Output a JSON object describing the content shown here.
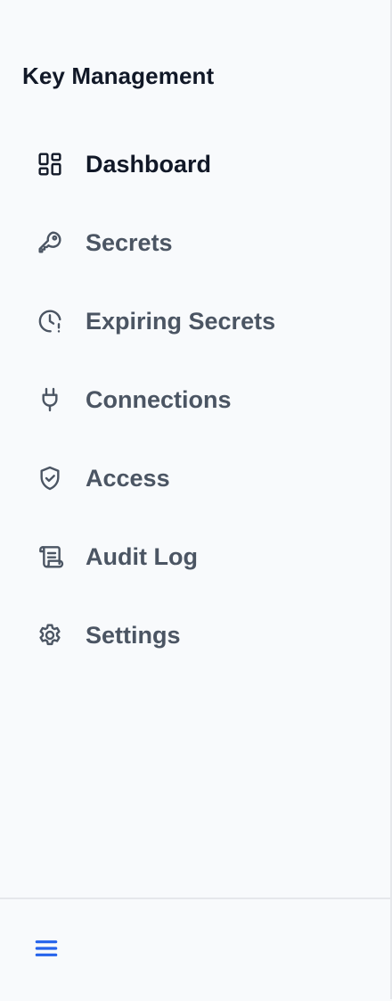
{
  "sidebar": {
    "title": "Key Management",
    "items": [
      {
        "label": "Dashboard",
        "icon": "dashboard-icon",
        "active": true
      },
      {
        "label": "Secrets",
        "icon": "key-icon",
        "active": false
      },
      {
        "label": "Expiring Secrets",
        "icon": "clock-alert-icon",
        "active": false
      },
      {
        "label": "Connections",
        "icon": "plug-icon",
        "active": false
      },
      {
        "label": "Access",
        "icon": "shield-check-icon",
        "active": false
      },
      {
        "label": "Audit Log",
        "icon": "scroll-icon",
        "active": false
      },
      {
        "label": "Settings",
        "icon": "gear-icon",
        "active": false
      }
    ]
  },
  "footer": {
    "menu_icon": "hamburger-menu-icon"
  },
  "colors": {
    "background": "#f8fafc",
    "text_active": "#111827",
    "text_default": "#4b5563",
    "accent": "#2563eb",
    "border": "#e5e7eb"
  }
}
